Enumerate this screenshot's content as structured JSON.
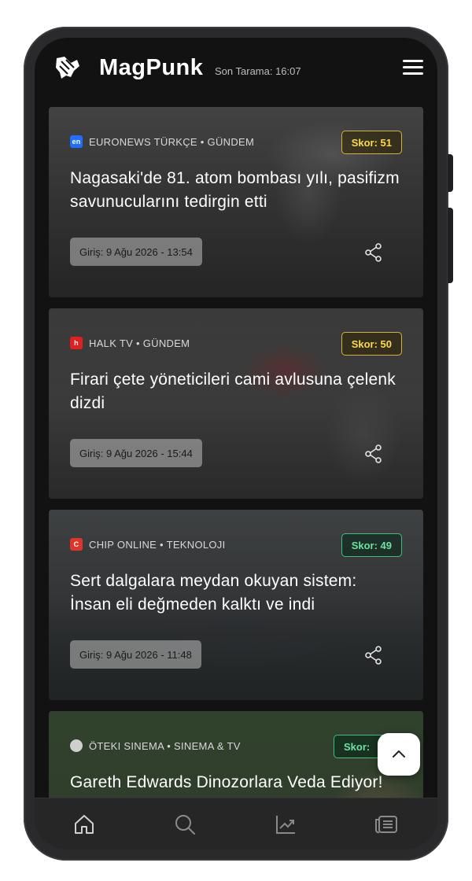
{
  "header": {
    "brand": "MagPunk",
    "scan_label": "Son Tarama: 16:07",
    "logo_icon": "handshake-logo-icon",
    "menu_icon": "hamburger-menu-icon"
  },
  "cards": [
    {
      "source": "EURONEWS TÜRKÇE • GÜNDEM",
      "source_icon": "euronews-icon",
      "source_icon_text": "en",
      "score": "Skor: 51",
      "score_color": "yellow",
      "title": "Nagasaki'de 81. atom bombası yılı, pasifizm savunucularını tedirgin etti",
      "date": "Giriş: 9 Ağu 2026 - 13:54"
    },
    {
      "source": "HALK TV • GÜNDEM",
      "source_icon": "halktv-icon",
      "source_icon_text": "h",
      "score": "Skor: 50",
      "score_color": "yellow",
      "title": "Firari çete yöneticileri cami avlusuna çelenk dizdi",
      "date": "Giriş: 9 Ağu 2026 - 15:44"
    },
    {
      "source": "CHIP ONLINE • TEKNOLOJI",
      "source_icon": "chip-online-icon",
      "source_icon_text": "C",
      "score": "Skor: 49",
      "score_color": "green",
      "title": "Sert dalgalara meydan okuyan sistem: İnsan eli değmeden kalktı ve indi",
      "date": "Giriş: 9 Ağu 2026 - 11:48"
    },
    {
      "source": "ÖTEKI SINEMA • SINEMA & TV",
      "source_icon": "oteki-sinema-icon",
      "source_icon_text": "",
      "score": "Skor:",
      "score_color": "green",
      "title": "Gareth Edwards Dinozorlara Veda Ediyor!",
      "date": ""
    }
  ],
  "bottom_nav": [
    {
      "icon": "home-icon"
    },
    {
      "icon": "search-icon"
    },
    {
      "icon": "trending-chart-icon"
    },
    {
      "icon": "news-list-icon"
    }
  ],
  "colors": {
    "accent_yellow": "#ffd84d",
    "accent_green": "#6be3a1",
    "background": "#121212"
  }
}
